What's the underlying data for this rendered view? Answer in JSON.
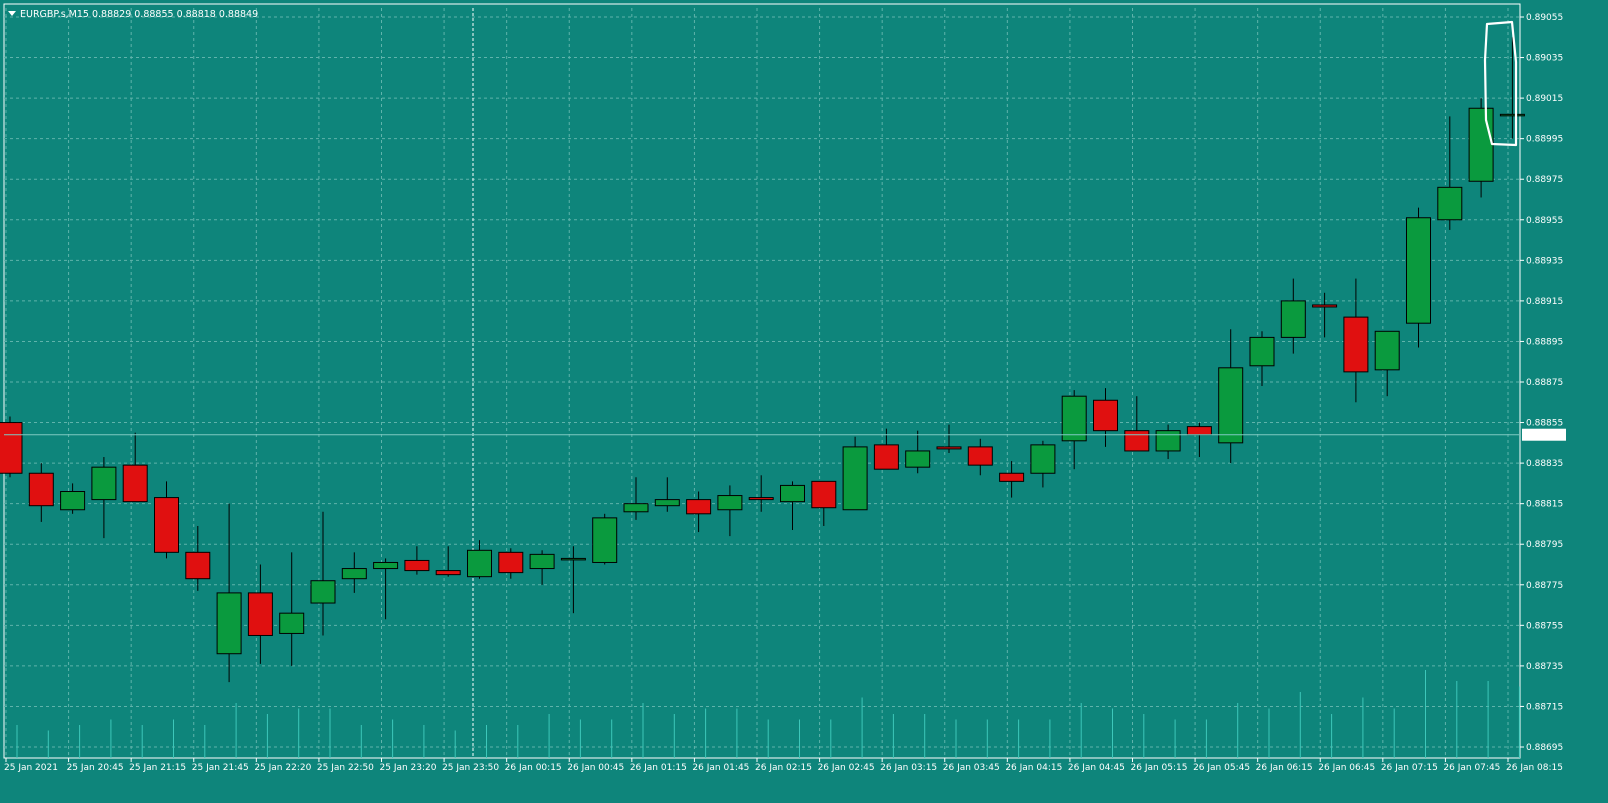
{
  "header": {
    "symbol": "EURGBP.s,M15",
    "open": "0.88829",
    "high": "0.88855",
    "low": "0.88818",
    "close": "0.88849"
  },
  "colors": {
    "background": "#0e857b",
    "grid": "#5fb3ab",
    "bull": "#0a9a3e",
    "bear": "#e01010",
    "text": "#ffffff",
    "annotation": "#ffffff"
  },
  "price_label": "0.88849",
  "chart_data": {
    "type": "candlestick",
    "ylim": [
      0.88695,
      0.89065
    ],
    "y_ticks": [
      "0.89055",
      "0.89035",
      "0.89015",
      "0.88995",
      "0.88975",
      "0.88955",
      "0.88935",
      "0.88915",
      "0.88895",
      "0.88875",
      "0.88855",
      "0.88835",
      "0.88815",
      "0.88795",
      "0.88775",
      "0.88755",
      "0.88735",
      "0.88715",
      "0.88695"
    ],
    "x_ticks": [
      "25 Jan 2021",
      "25 Jan 20:45",
      "25 Jan 21:15",
      "25 Jan 21:45",
      "25 Jan 22:20",
      "25 Jan 22:50",
      "25 Jan 23:20",
      "25 Jan 23:50",
      "26 Jan 00:15",
      "26 Jan 00:45",
      "26 Jan 01:15",
      "26 Jan 01:45",
      "26 Jan 02:15",
      "26 Jan 02:45",
      "26 Jan 03:15",
      "26 Jan 03:45",
      "26 Jan 04:15",
      "26 Jan 04:45",
      "26 Jan 05:15",
      "26 Jan 05:45",
      "26 Jan 06:15",
      "26 Jan 06:45",
      "26 Jan 07:15",
      "26 Jan 07:45",
      "26 Jan 08:15"
    ],
    "grid": true,
    "current_price": 0.88849,
    "candles": [
      {
        "o": 0.88855,
        "h": 0.88858,
        "l": 0.88828,
        "c": 0.8883
      },
      {
        "o": 0.8883,
        "h": 0.88835,
        "l": 0.88806,
        "c": 0.88814
      },
      {
        "o": 0.88812,
        "h": 0.88825,
        "l": 0.8881,
        "c": 0.88821
      },
      {
        "o": 0.88817,
        "h": 0.88838,
        "l": 0.88798,
        "c": 0.88833
      },
      {
        "o": 0.88834,
        "h": 0.8885,
        "l": 0.88816,
        "c": 0.88816
      },
      {
        "o": 0.88818,
        "h": 0.88826,
        "l": 0.88788,
        "c": 0.88791
      },
      {
        "o": 0.88791,
        "h": 0.88804,
        "l": 0.88772,
        "c": 0.88778
      },
      {
        "o": 0.88741,
        "h": 0.88815,
        "l": 0.88727,
        "c": 0.88771
      },
      {
        "o": 0.88771,
        "h": 0.88785,
        "l": 0.88736,
        "c": 0.8875
      },
      {
        "o": 0.88751,
        "h": 0.88791,
        "l": 0.88735,
        "c": 0.88761
      },
      {
        "o": 0.88766,
        "h": 0.88811,
        "l": 0.8875,
        "c": 0.88777
      },
      {
        "o": 0.88778,
        "h": 0.88791,
        "l": 0.88771,
        "c": 0.88783
      },
      {
        "o": 0.88783,
        "h": 0.88788,
        "l": 0.88758,
        "c": 0.88786
      },
      {
        "o": 0.88787,
        "h": 0.88794,
        "l": 0.8878,
        "c": 0.88782
      },
      {
        "o": 0.88782,
        "h": 0.88794,
        "l": 0.88779,
        "c": 0.8878
      },
      {
        "o": 0.88779,
        "h": 0.88797,
        "l": 0.88778,
        "c": 0.88792
      },
      {
        "o": 0.88791,
        "h": 0.88793,
        "l": 0.88778,
        "c": 0.88781
      },
      {
        "o": 0.88783,
        "h": 0.88792,
        "l": 0.88775,
        "c": 0.8879
      },
      {
        "o": 0.88788,
        "h": 0.88794,
        "l": 0.88761,
        "c": 0.88788
      },
      {
        "o": 0.88786,
        "h": 0.8881,
        "l": 0.88785,
        "c": 0.88808
      },
      {
        "o": 0.88811,
        "h": 0.88828,
        "l": 0.88807,
        "c": 0.88815
      },
      {
        "o": 0.88814,
        "h": 0.88828,
        "l": 0.88811,
        "c": 0.88817
      },
      {
        "o": 0.88817,
        "h": 0.88821,
        "l": 0.88801,
        "c": 0.8881
      },
      {
        "o": 0.88812,
        "h": 0.88824,
        "l": 0.88799,
        "c": 0.88819
      },
      {
        "o": 0.88818,
        "h": 0.88829,
        "l": 0.88811,
        "c": 0.88817
      },
      {
        "o": 0.88816,
        "h": 0.88826,
        "l": 0.88802,
        "c": 0.88824
      },
      {
        "o": 0.88826,
        "h": 0.88826,
        "l": 0.88804,
        "c": 0.88813
      },
      {
        "o": 0.88812,
        "h": 0.88848,
        "l": 0.88812,
        "c": 0.88843
      },
      {
        "o": 0.88844,
        "h": 0.88852,
        "l": 0.88832,
        "c": 0.88832
      },
      {
        "o": 0.88833,
        "h": 0.88851,
        "l": 0.8883,
        "c": 0.88841
      },
      {
        "o": 0.88843,
        "h": 0.88854,
        "l": 0.8884,
        "c": 0.88842
      },
      {
        "o": 0.88843,
        "h": 0.88847,
        "l": 0.88829,
        "c": 0.88834
      },
      {
        "o": 0.8883,
        "h": 0.88836,
        "l": 0.88818,
        "c": 0.88826
      },
      {
        "o": 0.8883,
        "h": 0.88846,
        "l": 0.88823,
        "c": 0.88844
      },
      {
        "o": 0.88846,
        "h": 0.88871,
        "l": 0.88832,
        "c": 0.88868
      },
      {
        "o": 0.88866,
        "h": 0.88872,
        "l": 0.88843,
        "c": 0.88851
      },
      {
        "o": 0.88851,
        "h": 0.88868,
        "l": 0.88841,
        "c": 0.88841
      },
      {
        "o": 0.88841,
        "h": 0.88854,
        "l": 0.88837,
        "c": 0.88851
      },
      {
        "o": 0.88853,
        "h": 0.88855,
        "l": 0.88838,
        "c": 0.88849
      },
      {
        "o": 0.88845,
        "h": 0.88901,
        "l": 0.88835,
        "c": 0.88882
      },
      {
        "o": 0.88883,
        "h": 0.889,
        "l": 0.88873,
        "c": 0.88897
      },
      {
        "o": 0.88897,
        "h": 0.88926,
        "l": 0.88889,
        "c": 0.88915
      },
      {
        "o": 0.88913,
        "h": 0.88919,
        "l": 0.88897,
        "c": 0.88912
      },
      {
        "o": 0.88907,
        "h": 0.88926,
        "l": 0.88865,
        "c": 0.8888
      },
      {
        "o": 0.88881,
        "h": 0.889,
        "l": 0.88868,
        "c": 0.889
      },
      {
        "o": 0.88904,
        "h": 0.88961,
        "l": 0.88892,
        "c": 0.88956
      },
      {
        "o": 0.88955,
        "h": 0.89006,
        "l": 0.8895,
        "c": 0.88971
      },
      {
        "o": 0.88974,
        "h": 0.89015,
        "l": 0.88966,
        "c": 0.8901
      },
      {
        "o": 0.89007,
        "h": 0.89045,
        "l": 0.88995,
        "c": 0.89007
      }
    ],
    "volume_heights": [
      0.3,
      0.25,
      0.3,
      0.35,
      0.3,
      0.35,
      0.3,
      0.5,
      0.4,
      0.45,
      0.45,
      0.3,
      0.35,
      0.3,
      0.25,
      0.3,
      0.3,
      0.4,
      0.35,
      0.35,
      0.5,
      0.4,
      0.45,
      0.45,
      0.35,
      0.35,
      0.35,
      0.55,
      0.4,
      0.4,
      0.35,
      0.35,
      0.35,
      0.35,
      0.5,
      0.45,
      0.4,
      0.35,
      0.35,
      0.5,
      0.45,
      0.6,
      0.4,
      0.55,
      0.45,
      0.8,
      0.7,
      0.7,
      0.65
    ]
  }
}
